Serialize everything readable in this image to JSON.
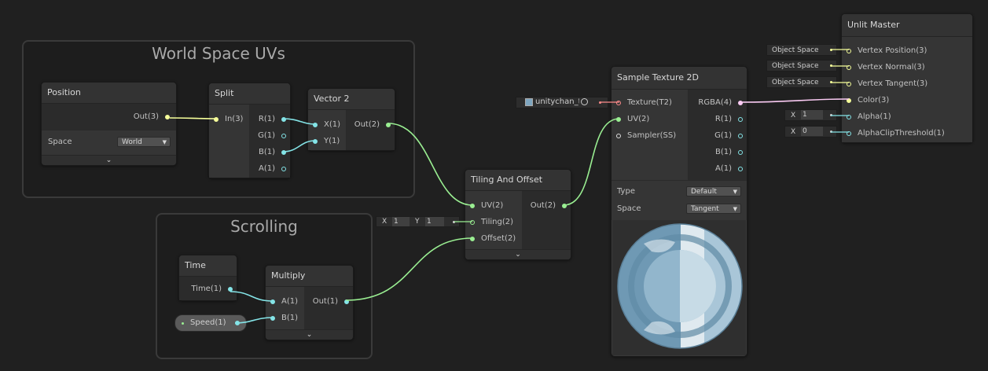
{
  "groups": {
    "world_space_uvs": "World Space UVs",
    "scrolling": "Scrolling"
  },
  "nodes": {
    "position": {
      "title": "Position",
      "out": "Out(3)",
      "space_label": "Space",
      "space_value": "World"
    },
    "split": {
      "title": "Split",
      "in": "In(3)",
      "outs": [
        "R(1)",
        "G(1)",
        "B(1)",
        "A(1)"
      ]
    },
    "vector2": {
      "title": "Vector 2",
      "ins": [
        "X(1)",
        "Y(1)"
      ],
      "out": "Out(2)"
    },
    "tiling_offset": {
      "title": "Tiling And Offset",
      "ins": [
        "UV(2)",
        "Tiling(2)",
        "Offset(2)"
      ],
      "out": "Out(2)",
      "tiling_field": {
        "x_label": "X",
        "x_value": "1",
        "y_label": "Y",
        "y_value": "1"
      }
    },
    "time": {
      "title": "Time",
      "out": "Time(1)"
    },
    "multiply": {
      "title": "Multiply",
      "ins": [
        "A(1)",
        "B(1)"
      ],
      "out": "Out(1)"
    },
    "speed": {
      "label": "Speed(1)"
    },
    "sample_texture": {
      "title": "Sample Texture 2D",
      "ins": [
        "Texture(T2)",
        "UV(2)",
        "Sampler(SS)"
      ],
      "outs": [
        "RGBA(4)",
        "R(1)",
        "G(1)",
        "B(1)",
        "A(1)"
      ],
      "type_label": "Type",
      "type_value": "Default",
      "space_label": "Space",
      "space_value": "Tangent",
      "texture_field": "unitychan_t"
    },
    "unlit_master": {
      "title": "Unlit Master",
      "ins": [
        "Vertex Position(3)",
        "Vertex Normal(3)",
        "Vertex Tangent(3)",
        "Color(3)",
        "Alpha(1)",
        "AlphaClipThreshold(1)"
      ],
      "space_fields": [
        "Object Space",
        "Object Space",
        "Object Space"
      ],
      "alpha_field": {
        "axis": "X",
        "value": "1"
      },
      "clip_field": {
        "axis": "X",
        "value": "0"
      }
    }
  },
  "colors": {
    "vector3": "#f6ff9a",
    "vector2": "#9aef92",
    "vector1": "#84e4e7",
    "vector4": "#fbcbf4",
    "texture": "#ff8b8b",
    "sampler": "#dcdcdc"
  }
}
